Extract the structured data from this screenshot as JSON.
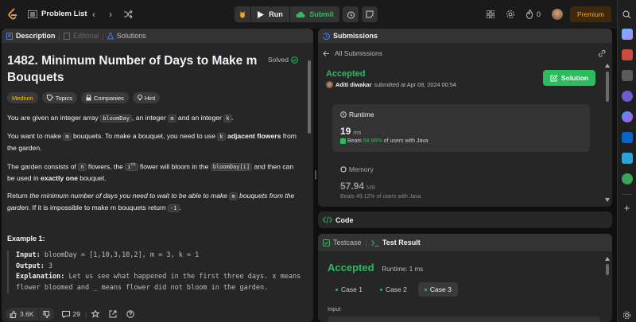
{
  "topbar": {
    "problem_list": "Problem List",
    "run": "Run",
    "submit": "Submit",
    "streak": "0",
    "premium": "Premium"
  },
  "left_tabs": {
    "description": "Description",
    "editorial": "Editorial",
    "solutions": "Solutions"
  },
  "problem": {
    "title": "1482. Minimum Number of Days to Make m Bouquets",
    "solved": "Solved",
    "difficulty": "Medium",
    "tags": [
      "Topics",
      "Companies",
      "Hint"
    ],
    "p1_a": "You are given an integer array ",
    "p1_code1": "bloomDay",
    "p1_b": ", an integer ",
    "p1_code2": "m",
    "p1_c": " and an integer ",
    "p1_code3": "k",
    "p1_d": ".",
    "p2_a": "You want to make ",
    "p2_code1": "m",
    "p2_b": " bouquets. To make a bouquet, you need to use ",
    "p2_code2": "k",
    "p2_bold": "adjacent flowers",
    "p2_c": " from the garden.",
    "p3_a": "The garden consists of ",
    "p3_code1": "n",
    "p3_b": " flowers, the ",
    "p3_code2": "i",
    "p3_sup": "th",
    "p3_c": " flower will bloom in the ",
    "p3_code3": "bloomDay[i]",
    "p3_d": " and then can be used in ",
    "p3_bold": "exactly one",
    "p3_e": " bouquet.",
    "p4_a": "Return ",
    "p4_ital1": "the minimum number of days you need to wait to be able to make ",
    "p4_code1": "m",
    "p4_ital2": " bouquets from the garden",
    "p4_b": ". If it is impossible to make m bouquets return ",
    "p4_code2": "-1",
    "p4_c": ".",
    "example_title": "Example 1:",
    "ex_input_label": "Input:",
    "ex_input": " bloomDay = [1,10,3,10,2], m = 3, k = 1",
    "ex_output_label": "Output:",
    "ex_output": " 3",
    "ex_expl_label": "Explanation:",
    "ex_expl": " Let us see what happened in the first three days. x means flower bloomed and _ means flower did not bloom in the garden."
  },
  "left_footer": {
    "likes": "3.6K",
    "comments": "29"
  },
  "submissions": {
    "tab": "Submissions",
    "all": "All Submissions",
    "status": "Accepted",
    "user": "Aditi diwakar",
    "submitted_at": " submitted at Apr 08, 2024 00:54",
    "solution_btn": "Solution",
    "runtime_label": "Runtime",
    "runtime_value": "19",
    "runtime_unit": "ms",
    "runtime_beats_a": "Beats ",
    "runtime_beats_pct": "68.96%",
    "runtime_beats_b": " of users with Java",
    "memory_label": "Memory",
    "memory_value": "57.94",
    "memory_unit": "MB",
    "memory_beats_a": "Beats ",
    "memory_beats_pct": "49.12%",
    "memory_beats_b": " of users with Java"
  },
  "code_panel": {
    "title": "Code"
  },
  "testcase": {
    "tab_testcase": "Testcase",
    "tab_result": "Test Result",
    "status": "Accepted",
    "runtime": "Runtime: 1 ms",
    "cases": [
      "Case 1",
      "Case 2",
      "Case 3"
    ],
    "input_label": "Input"
  },
  "colors": {
    "accent_green": "#2cbb5d",
    "medium_yellow": "#ffc01e",
    "premium": "#ffa116"
  }
}
